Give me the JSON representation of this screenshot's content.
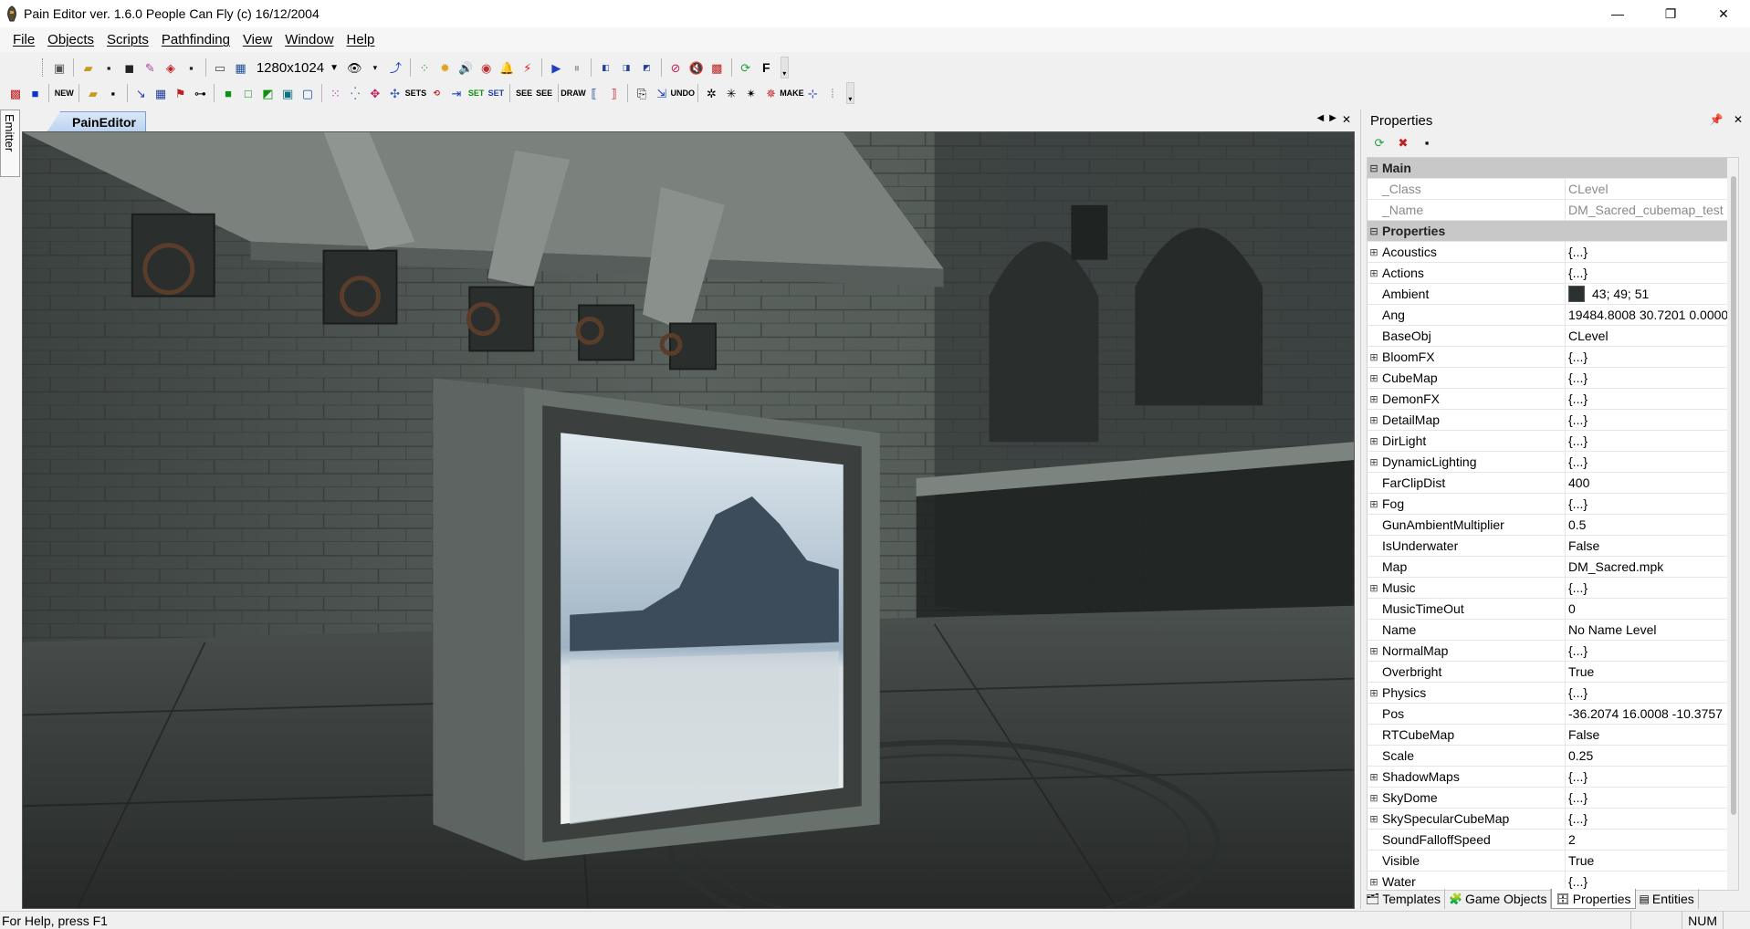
{
  "window": {
    "title": "Pain Editor  ver. 1.6.0  People Can Fly (c) 16/12/2004",
    "controls": [
      "—",
      "❐",
      "✕"
    ]
  },
  "menu": [
    "File",
    "Objects",
    "Scripts",
    "Pathfinding",
    "View",
    "Window",
    "Help"
  ],
  "toolbar1": {
    "resolution": "1280x1024",
    "letter_button": "F"
  },
  "toolbar2": {
    "labels": [
      "NEW",
      "SETS",
      "SET",
      "SET",
      "SEE",
      "SEE",
      "DRAW",
      "UNDO",
      "MAKE"
    ]
  },
  "side_tab": "Emitter",
  "document_tab": "PainEditor",
  "properties": {
    "header": "Properties",
    "categories": {
      "main": "Main",
      "properties": "Properties"
    },
    "main_rows": [
      {
        "name": "_Class",
        "value": "CLevel"
      },
      {
        "name": "_Name",
        "value": "DM_Sacred_cubemap_test"
      }
    ],
    "rows": [
      {
        "name": "Acoustics",
        "value": "{...}",
        "expandable": true
      },
      {
        "name": "Actions",
        "value": "{...}",
        "expandable": true
      },
      {
        "name": "Ambient",
        "value": "43; 49; 51",
        "expandable": false,
        "color": "#2b3133"
      },
      {
        "name": "Ang",
        "value": "19484.8008 30.7201 0.0000",
        "expandable": false
      },
      {
        "name": "BaseObj",
        "value": "CLevel",
        "expandable": false
      },
      {
        "name": "BloomFX",
        "value": "{...}",
        "expandable": true
      },
      {
        "name": "CubeMap",
        "value": "{...}",
        "expandable": true
      },
      {
        "name": "DemonFX",
        "value": "{...}",
        "expandable": true
      },
      {
        "name": "DetailMap",
        "value": "{...}",
        "expandable": true
      },
      {
        "name": "DirLight",
        "value": "{...}",
        "expandable": true
      },
      {
        "name": "DynamicLighting",
        "value": "{...}",
        "expandable": true
      },
      {
        "name": "FarClipDist",
        "value": "400",
        "expandable": false
      },
      {
        "name": "Fog",
        "value": "{...}",
        "expandable": true
      },
      {
        "name": "GunAmbientMultiplier",
        "value": "0.5",
        "expandable": false
      },
      {
        "name": "IsUnderwater",
        "value": "False",
        "expandable": false
      },
      {
        "name": "Map",
        "value": "DM_Sacred.mpk",
        "expandable": false
      },
      {
        "name": "Music",
        "value": "{...}",
        "expandable": true
      },
      {
        "name": "MusicTimeOut",
        "value": "0",
        "expandable": false
      },
      {
        "name": "Name",
        "value": "No Name Level",
        "expandable": false
      },
      {
        "name": "NormalMap",
        "value": "{...}",
        "expandable": true
      },
      {
        "name": "Overbright",
        "value": "True",
        "expandable": false
      },
      {
        "name": "Physics",
        "value": "{...}",
        "expandable": true
      },
      {
        "name": "Pos",
        "value": "-36.2074 16.0008 -10.3757",
        "expandable": false
      },
      {
        "name": "RTCubeMap",
        "value": "False",
        "expandable": false
      },
      {
        "name": "Scale",
        "value": "0.25",
        "expandable": false
      },
      {
        "name": "ShadowMaps",
        "value": "{...}",
        "expandable": true
      },
      {
        "name": "SkyDome",
        "value": "{...}",
        "expandable": true
      },
      {
        "name": "SkySpecularCubeMap",
        "value": "{...}",
        "expandable": true
      },
      {
        "name": "SoundFalloffSpeed",
        "value": "2",
        "expandable": false
      },
      {
        "name": "Visible",
        "value": "True",
        "expandable": false
      },
      {
        "name": "Water",
        "value": "{...}",
        "expandable": true
      }
    ]
  },
  "bottom_tabs": [
    "Templates",
    "Game Objects",
    "Properties",
    "Entities"
  ],
  "status": {
    "text": "For Help, press F1",
    "num": "NUM"
  }
}
